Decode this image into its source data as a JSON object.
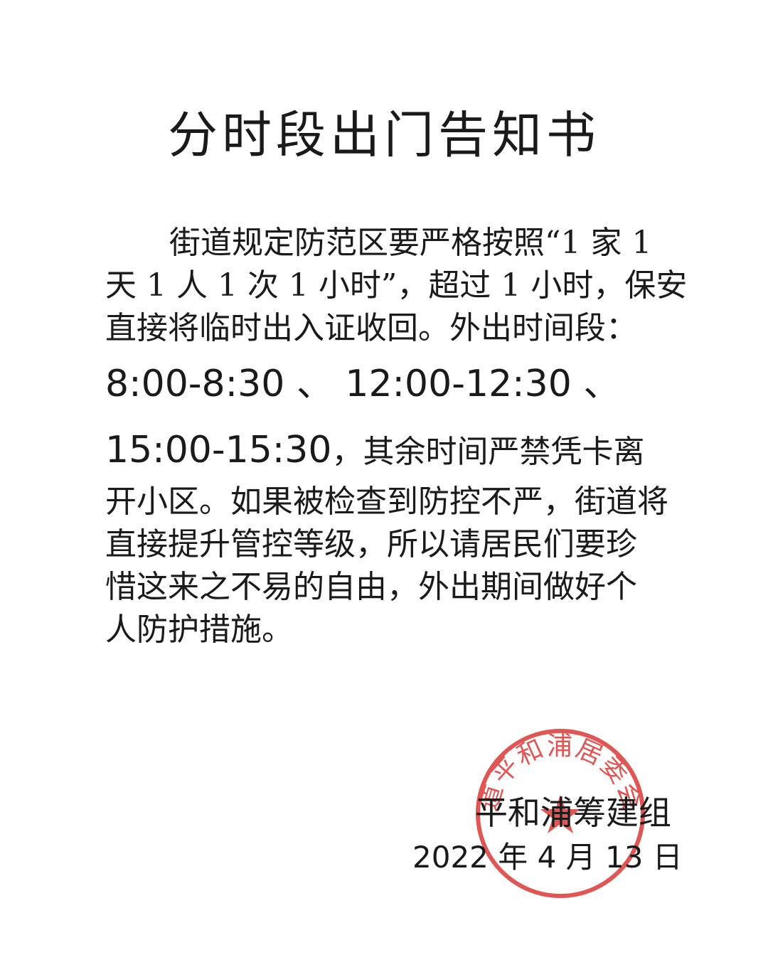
{
  "notice": {
    "title": "分时段出门告知书",
    "lines": [
      "街道规定防范区要严格按照“1 家 1",
      "天 1 人 1 次 1 小时”，超过 1 小时，保安",
      "直接将临时出入证收回。外出时间段：",
      "8:00-8:30 、 12:00-12:30 、",
      "15:00-15:30",
      "，其余时间严禁凭卡离",
      "开小区。如果被检查到防控不严，街道将",
      "直接提升管控等级，所以请居民们要珍",
      "惜这来之不易的自由，外出期间做好个",
      "人防护措施。"
    ]
  },
  "signature": {
    "org": "平和浦筹建组",
    "date": "2022 年 4 月 13 日"
  },
  "stamp": {
    "text": "道平和浦居委会",
    "color": "#d9322f"
  }
}
